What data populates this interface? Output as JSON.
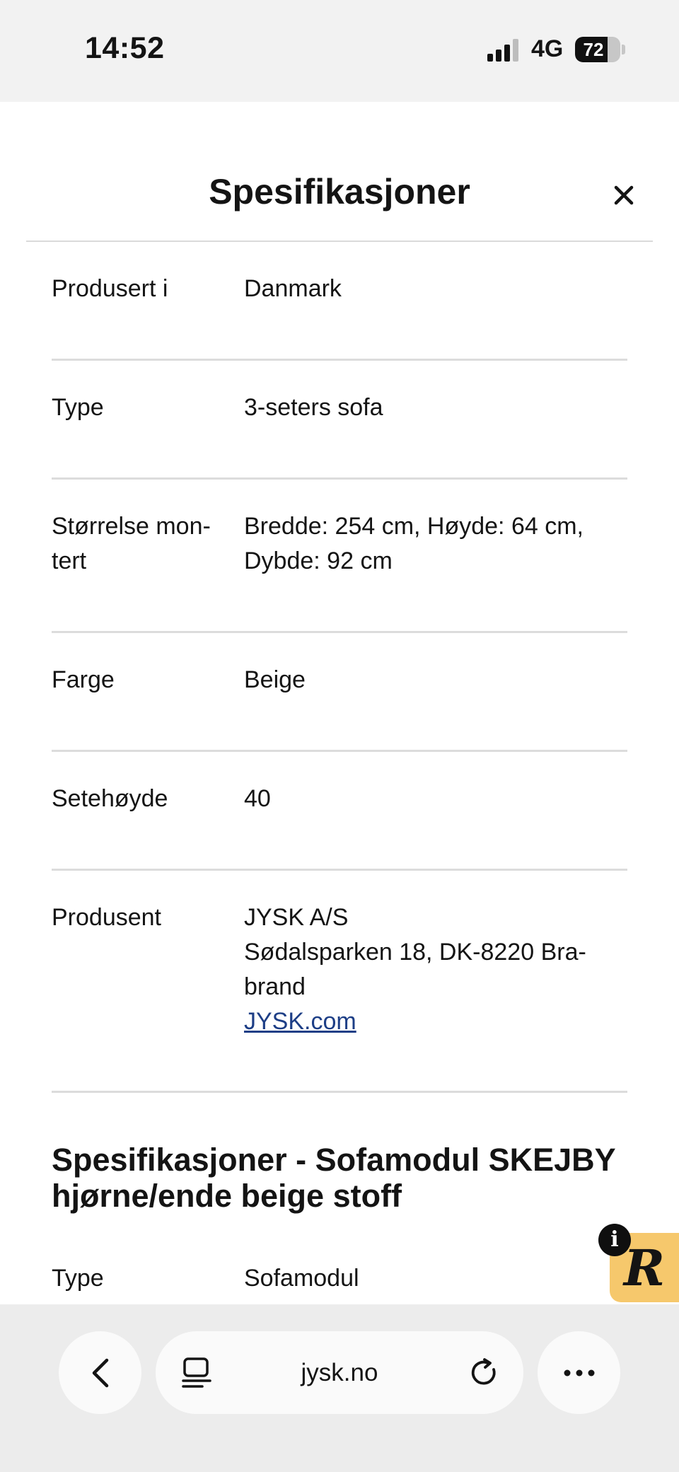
{
  "status_bar": {
    "time": "14:52",
    "network": "4G",
    "battery_level": "72",
    "battery_fraction": 0.72,
    "signal_icon": "signal-bars-icon"
  },
  "sheet": {
    "title": "Spesifikasjoner",
    "close_icon": "close-icon",
    "rows": [
      {
        "label": "Produsert i",
        "value_lines": [
          "Danmark"
        ]
      },
      {
        "label": "Type",
        "value_lines": [
          "3-seters sofa"
        ]
      },
      {
        "label_lines": [
          "Størrelse mon-",
          "tert"
        ],
        "value_lines": [
          "Bredde: 254 cm, Høyde: 64 cm,",
          "Dybde: 92 cm"
        ]
      },
      {
        "label": "Farge",
        "value_lines": [
          "Beige"
        ]
      },
      {
        "label": "Setehøyde",
        "value_lines": [
          "40"
        ]
      },
      {
        "label": "Produsent",
        "value_lines": [
          "JYSK A/S",
          "Sødalsparken 18, DK-8220 Bra-",
          "brand"
        ],
        "link": "JYSK.com"
      }
    ],
    "section_title_lines": [
      "Spesifikasjoner - Sofamodul SKEJBY",
      "hjørne/ende beige stoff"
    ],
    "extra_row": {
      "label": "Type",
      "value": "Sofamodul"
    }
  },
  "badge": {
    "letter": "R",
    "info": "i",
    "color": "#f6c86c"
  },
  "browser_bar": {
    "url": "jysk.no",
    "back_icon": "chevron-left-icon",
    "tabs_icon": "tabs-icon",
    "reload_icon": "reload-icon",
    "more_icon": "more-dots-icon"
  }
}
